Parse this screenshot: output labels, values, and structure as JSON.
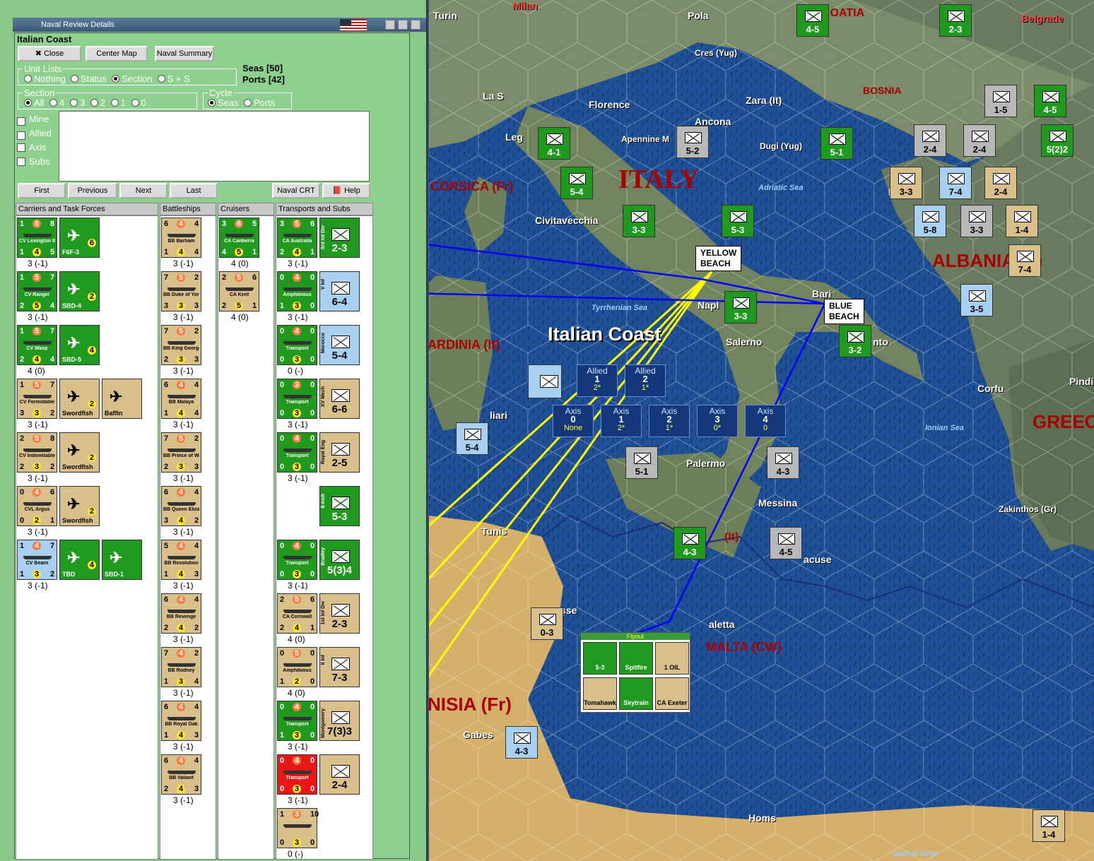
{
  "window": {
    "title": "Naval Review Details"
  },
  "panel": {
    "title": "Italian Coast",
    "buttons": {
      "close": "Close",
      "center_map": "Center Map",
      "naval_summary": "Naval Summary",
      "first": "First",
      "previous": "Previous",
      "next": "Next",
      "last": "Last",
      "naval_crt": "Naval CRT",
      "help": "Help"
    },
    "seas": "Seas [50]",
    "ports": "Ports [42]",
    "unit_lists": {
      "title": "Unit Lists",
      "options": [
        "Nothing",
        "Status",
        "Section",
        "S + S"
      ],
      "selected": "Section"
    },
    "section": {
      "title": "Section",
      "options": [
        "All",
        "4",
        "3",
        "2",
        "1",
        "0"
      ],
      "selected": "All"
    },
    "cycle": {
      "title": "Cycle",
      "options": [
        "Seas",
        "Ports"
      ],
      "selected": "Seas"
    },
    "filters": [
      {
        "label": "Mine",
        "checked": true
      },
      {
        "label": "Allied",
        "checked": true
      },
      {
        "label": "Axis",
        "checked": false
      },
      {
        "label": "Subs",
        "checked": false
      }
    ],
    "columns": [
      "Carriers and Task Forces",
      "Battleships",
      "Cruisers",
      "Transports and Subs"
    ],
    "carriers": [
      {
        "ship": "CV Lexington II",
        "tl": "1",
        "tm": "6",
        "tr": "8",
        "bl": "1",
        "bm": "4",
        "br": "5",
        "air": "F6F-3",
        "air_val": "6",
        "status": "3 (-1)"
      },
      {
        "ship": "CV Ranger",
        "tl": "1",
        "tm": "5",
        "tr": "7",
        "bl": "2",
        "bm": "5",
        "br": "4",
        "air": "SBD-4",
        "air_val": "2",
        "status": "3 (-1)"
      },
      {
        "ship": "CV Wasp",
        "tl": "1",
        "tm": "5",
        "tr": "7",
        "bl": "2",
        "bm": "4",
        "br": "4",
        "air": "SBD-5",
        "air_val": "4",
        "status": "4 (0)"
      },
      {
        "ship": "CV Formidable",
        "tl": "1",
        "tm": "5",
        "tr": "7",
        "bl": "3",
        "bm": "3",
        "br": "2",
        "air": "Swordfish",
        "air2": "Baffin",
        "air_val": "2",
        "status": "3 (-1)"
      },
      {
        "ship": "CV Indomitable",
        "tl": "2",
        "tm": "5",
        "tr": "8",
        "bl": "2",
        "bm": "3",
        "br": "2",
        "air": "Swordfish",
        "air_val": "2",
        "status": "3 (-1)"
      },
      {
        "ship": "CVL Argus",
        "tl": "0",
        "tm": "4",
        "tr": "6",
        "bl": "0",
        "bm": "2",
        "br": "1",
        "air": "Swordfish",
        "air_val": "2",
        "status": "3 (-1)"
      },
      {
        "ship": "CV Bearn",
        "tl": "1",
        "tm": "4",
        "tr": "7",
        "bl": "1",
        "bm": "3",
        "br": "2",
        "air": "TBD",
        "air2": "SBD-1",
        "air_val": "4",
        "status": "3 (-1)"
      }
    ],
    "battleships": [
      {
        "ship": "BB Barham",
        "tl": "6",
        "tm": "4",
        "tr": "4",
        "bl": "1",
        "bm": "4",
        "br": "4",
        "status": "3 (-1)"
      },
      {
        "ship": "BB Duke of York",
        "tl": "7",
        "tm": "5",
        "tr": "2",
        "bl": "3",
        "bm": "3",
        "br": "3",
        "status": "3 (-1)"
      },
      {
        "ship": "BB King George V",
        "tl": "7",
        "tm": "5",
        "tr": "2",
        "bl": "2",
        "bm": "3",
        "br": "3",
        "status": "3 (-1)"
      },
      {
        "ship": "BB Malaya",
        "tl": "6",
        "tm": "4",
        "tr": "4",
        "bl": "1",
        "bm": "4",
        "br": "4",
        "status": "3 (-1)"
      },
      {
        "ship": "BB Prince of Wales",
        "tl": "7",
        "tm": "5",
        "tr": "2",
        "bl": "2",
        "bm": "3",
        "br": "3",
        "status": "3 (-1)"
      },
      {
        "ship": "BB Queen Elizabeth",
        "tl": "6",
        "tm": "4",
        "tr": "4",
        "bl": "3",
        "bm": "4",
        "br": "2",
        "status": "3 (-1)"
      },
      {
        "ship": "BB Resolution",
        "tl": "5",
        "tm": "4",
        "tr": "4",
        "bl": "1",
        "bm": "4",
        "br": "3",
        "status": "3 (-1)"
      },
      {
        "ship": "BB Revenge",
        "tl": "6",
        "tm": "4",
        "tr": "4",
        "bl": "2",
        "bm": "4",
        "br": "2",
        "status": "3 (-1)"
      },
      {
        "ship": "BB Rodney",
        "tl": "7",
        "tm": "4",
        "tr": "2",
        "bl": "1",
        "bm": "3",
        "br": "4",
        "status": "3 (-1)"
      },
      {
        "ship": "BB Royal Oak",
        "tl": "6",
        "tm": "4",
        "tr": "4",
        "bl": "1",
        "bm": "4",
        "br": "3",
        "status": "3 (-1)"
      },
      {
        "ship": "BB Valiant",
        "tl": "6",
        "tm": "4",
        "tr": "4",
        "bl": "2",
        "bm": "4",
        "br": "3",
        "status": "3 (-1)"
      }
    ],
    "cruisers": [
      {
        "ship": "CA Canberra",
        "tl": "3",
        "tm": "6",
        "tr": "5",
        "bl": "4",
        "bm": "5",
        "br": "1",
        "status": "4 (0)"
      },
      {
        "ship": "CA Kent",
        "tl": "2",
        "tm": "5",
        "tr": "6",
        "bl": "2",
        "bm": "5",
        "br": "1",
        "status": "4 (0)"
      }
    ],
    "transports": [
      {
        "ship": "CA Australia",
        "tl": "3",
        "tm": "5",
        "tr": "6",
        "bl": "2",
        "bm": "4",
        "br": "1",
        "unit": "3rd Inf Div",
        "unit_val": "2-3",
        "status": "3 (-1)"
      },
      {
        "ship": "Amphibious",
        "tl": "0",
        "tm": "4",
        "tr": "0",
        "bl": "1",
        "bm": "3",
        "br": "0",
        "unit": "V Inf",
        "unit_val": "6-4",
        "status": "3 (-1)"
      },
      {
        "ship": "Transport",
        "tl": "0",
        "tm": "4",
        "tr": "0",
        "bl": "0",
        "bm": "3",
        "br": "0",
        "unit": "Morocco",
        "unit_val": "5-4",
        "status": "0 (-)"
      },
      {
        "ship": "Transport",
        "tl": "0",
        "tm": "3",
        "tr": "0",
        "bl": "0",
        "bm": "3",
        "br": "0",
        "unit": "XV Mech",
        "unit_val": "6-6",
        "status": "3 (-1)"
      },
      {
        "ship": "Transport",
        "tl": "0",
        "tm": "4",
        "tr": "0",
        "bl": "0",
        "bm": "3",
        "br": "0",
        "unit": "Royal Eng",
        "unit_val": "2-5",
        "unit2": "8-inch",
        "unit2_val": "5-3",
        "status": "3 (-1)"
      },
      {
        "ship": "Transport",
        "tl": "0",
        "tm": "4",
        "tr": "0",
        "bl": "0",
        "bm": "3",
        "br": "0",
        "unit": "Bradley",
        "unit_val": "5(3)4",
        "status": "3 (-1)"
      },
      {
        "ship": "CA Cornwall",
        "tl": "2",
        "tm": "5",
        "tr": "6",
        "bl": "2",
        "bm": "4",
        "br": "1",
        "unit": "1st Inf Div",
        "unit_val": "2-3",
        "status": "4 (0)"
      },
      {
        "ship": "Amphibious",
        "tl": "0",
        "tm": "5",
        "tr": "0",
        "bl": "1",
        "bm": "2",
        "br": "0",
        "unit": "II Inf",
        "unit_val": "7-3",
        "status": "4 (0)"
      },
      {
        "ship": "Transport",
        "tl": "0",
        "tm": "4",
        "tr": "0",
        "bl": "1",
        "bm": "3",
        "br": "0",
        "unit": "Montgomery",
        "unit_val": "7(3)3",
        "status": "3 (-1)"
      },
      {
        "ship": "Transport",
        "tl": "0",
        "tm": "4",
        "tr": "0",
        "bl": "0",
        "bm": "3",
        "br": "0",
        "unit": "",
        "unit_val": "2-4",
        "status": "3 (-1)"
      },
      {
        "ship": "",
        "tl": "1",
        "tm": "3",
        "tr": "10",
        "bl": "0",
        "bm": "3",
        "br": "0",
        "unit": "",
        "unit_val": "",
        "status": "0 (-)"
      }
    ]
  },
  "map": {
    "labels": {
      "italy": "ITALY",
      "italian_coast": "Italian Coast",
      "corsica": "CORSICA (Fr)",
      "sardinia": "ARDINIA (It)",
      "albania": "ALBANIA (It)",
      "greece": "GREEC",
      "croatia": "ROATIA",
      "bosnia": "BOSNIA",
      "malta": "MALTA (CW)",
      "tunisia": "NISIA (Fr)",
      "sicily": "(It)",
      "tyrrhenian": "Tyrrhenian Sea",
      "adriatic": "Adriatic Sea",
      "ionian": "Ionian Sea",
      "sirte": "Gulf of Sirte",
      "turin": "Turin",
      "milan": "Milan",
      "pola": "Pola",
      "belgrade": "Belgrade",
      "cres": "Cres (Yug)",
      "zara": "Zara (It)",
      "florence": "Florence",
      "ancona": "Ancona",
      "apennine": "Apennine M",
      "dugi": "Dugi (Yug)",
      "la_spezia": "La S",
      "leghorn": "Leg",
      "civitavecchia": "Civitavecchia",
      "napl": "Napl",
      "bari": "Bari",
      "salerno": "Salerno",
      "taranto": "nto",
      "palermo": "Palermo",
      "messina": "Messina",
      "syracuse": "acuse",
      "tunis": "Tunis",
      "valetta": "aletta",
      "gabes": "Gabes",
      "homs": "Homs",
      "corfu": "Corfu",
      "zakinthos": "Zakinthos (Gr)",
      "cagliari": "liari",
      "durazzo": "Du",
      "pindus": "Pindi",
      "sse": "sse"
    },
    "beaches": {
      "yellow": "YELLOW\nBEACH",
      "blue": "BLUE\nBEACH"
    },
    "allied_sections": [
      {
        "label": "Allied",
        "n": "1",
        "v": "2*"
      },
      {
        "label": "Allied",
        "n": "2",
        "v": "1*"
      }
    ],
    "axis_sections": [
      {
        "label": "Axis",
        "n": "0",
        "v": "None"
      },
      {
        "label": "Axis",
        "n": "1",
        "v": "2*"
      },
      {
        "label": "Axis",
        "n": "2",
        "v": "1*"
      },
      {
        "label": "Axis",
        "n": "3",
        "v": "0*"
      },
      {
        "label": "Axis",
        "n": "4",
        "v": "0"
      }
    ],
    "flyout_title": "Flyout",
    "flyout_items": [
      "5-3",
      "Spitfire",
      "1 OIL",
      "Tomahawk",
      "Skytrain",
      "CA Exeter"
    ],
    "units": [
      {
        "v": "4-5",
        "c": "g"
      },
      {
        "v": "2-3",
        "c": "g"
      },
      {
        "v": "4-5",
        "c": "g"
      },
      {
        "v": "1-5",
        "c": "s"
      },
      {
        "v": "4-1",
        "c": "g"
      },
      {
        "v": "5-2",
        "c": "s"
      },
      {
        "v": "5-1",
        "c": "g"
      },
      {
        "v": "5-4",
        "c": "g"
      },
      {
        "v": "3-3",
        "c": "g"
      },
      {
        "v": "5-3",
        "c": "g"
      },
      {
        "v": "3-3",
        "c": "g"
      },
      {
        "v": "3-2",
        "c": "g"
      },
      {
        "v": "2-4",
        "c": "s"
      },
      {
        "v": "2-4",
        "c": "s"
      },
      {
        "v": "3-3",
        "c": "t"
      },
      {
        "v": "7-4",
        "c": "b"
      },
      {
        "v": "2-4",
        "c": "t"
      },
      {
        "v": "5-8",
        "c": "b"
      },
      {
        "v": "3-3",
        "c": "s"
      },
      {
        "v": "1-4",
        "c": "t"
      },
      {
        "v": "7-4",
        "c": "t"
      },
      {
        "v": "3-5",
        "c": "b"
      },
      {
        "v": "5-4",
        "c": "b"
      },
      {
        "v": "5-1",
        "c": "s"
      },
      {
        "v": "4-3",
        "c": "s"
      },
      {
        "v": "4-3",
        "c": "g"
      },
      {
        "v": "4-5",
        "c": "s"
      },
      {
        "v": "0-3",
        "c": "t"
      },
      {
        "v": "4-3",
        "c": "b"
      },
      {
        "v": "1-4",
        "c": "t"
      },
      {
        "v": "5(2)2",
        "c": "g"
      },
      {
        "v": "4-5",
        "c": "g"
      }
    ]
  },
  "colors": {
    "panel": "#8ed08e",
    "sea": "#1f4f95",
    "land": "#6d8a5c",
    "yellow_line": "#ffff00",
    "blue_line": "#0000ff",
    "axis_red": "#a00000"
  }
}
